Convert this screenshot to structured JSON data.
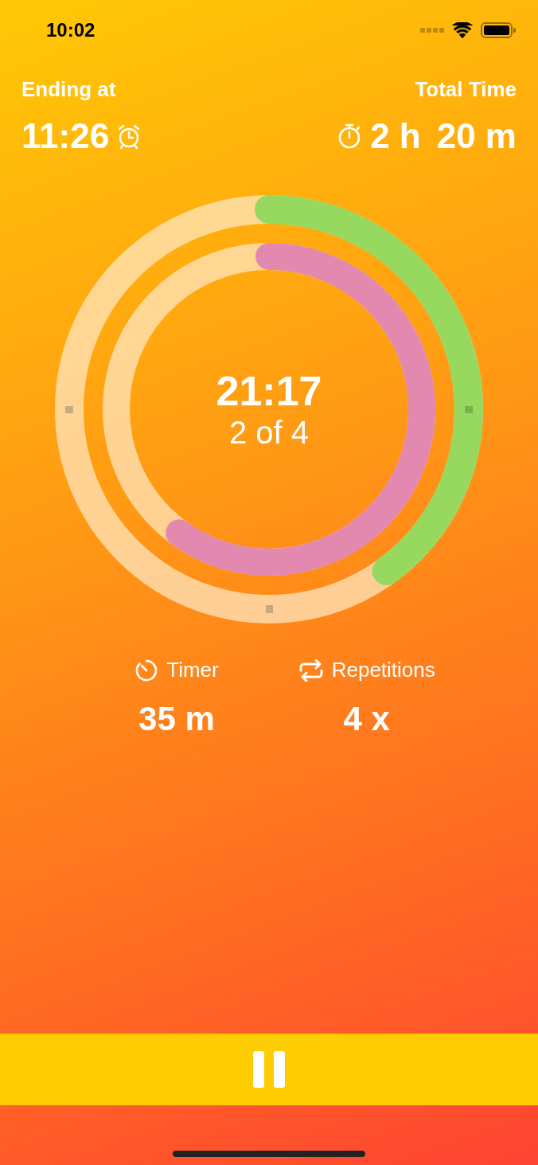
{
  "status_bar": {
    "time": "10:02"
  },
  "ending": {
    "label": "Ending at",
    "value": "11:26"
  },
  "total": {
    "label": "Total Time",
    "hours": "2 h",
    "minutes": "20 m"
  },
  "rings": [
    {
      "color": "#97d95f"
    },
    {
      "color": "#e389b0"
    }
  ],
  "center": {
    "time": "21:17",
    "round": "2 of 4"
  },
  "stats": [
    {
      "kind": "timer",
      "label": "Timer",
      "value": "35 m"
    },
    {
      "kind": "repeat",
      "label": "Repetitions",
      "value": "4 x"
    }
  ]
}
